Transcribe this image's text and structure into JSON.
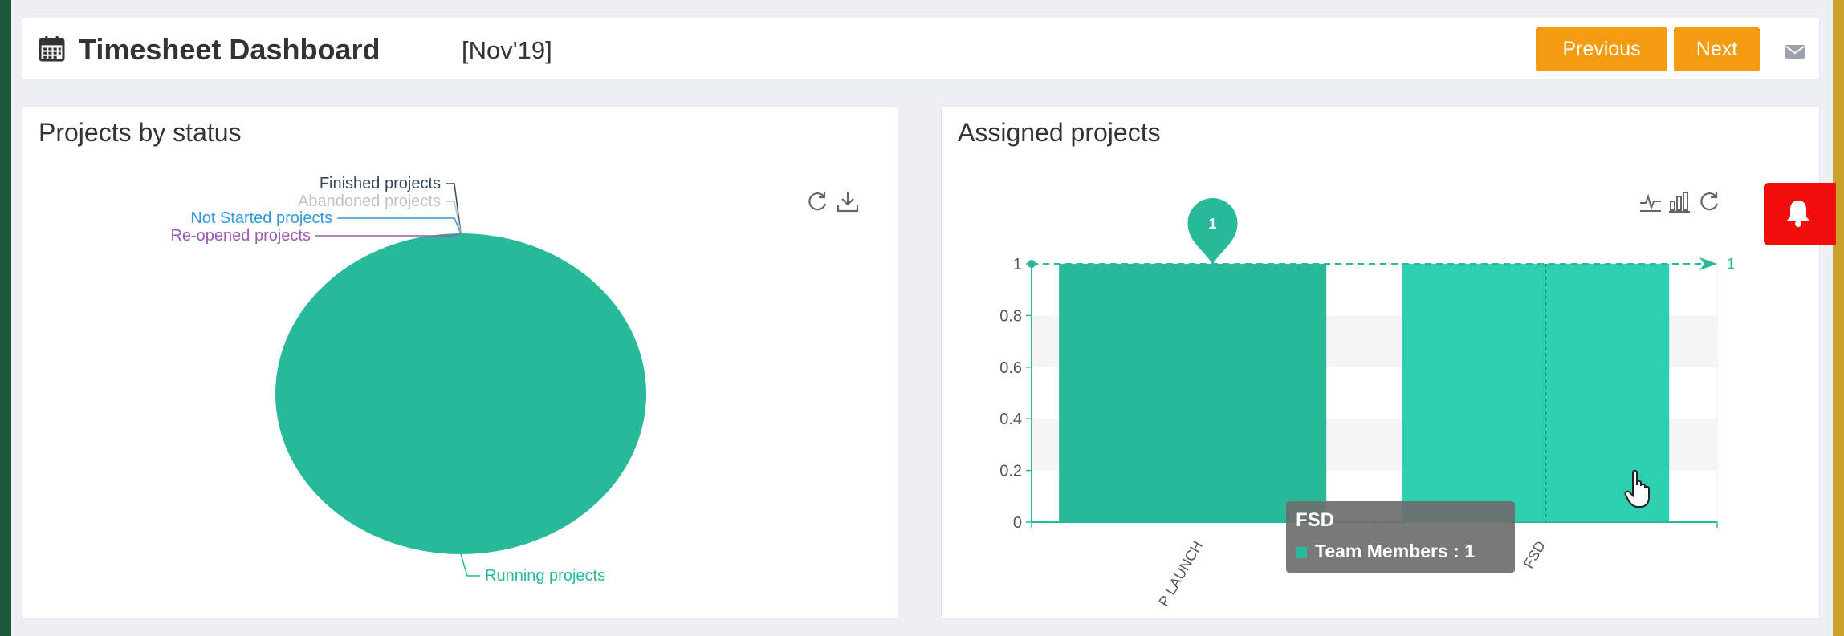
{
  "header": {
    "title": "Timesheet Dashboard",
    "period": "[Nov'19]",
    "icon": "calendar-icon",
    "previous_label": "Previous",
    "next_label": "Next",
    "mail_icon": "envelope-icon"
  },
  "projects_by_status": {
    "title": "Projects by status",
    "tools": [
      "refresh-icon",
      "download-icon"
    ],
    "chart_data": {
      "type": "pie",
      "categories": [
        "Finished projects",
        "Abandoned projects",
        "Not Started projects",
        "Re-opened projects",
        "Running projects"
      ],
      "values": [
        0,
        0,
        0,
        0,
        1
      ],
      "colors": [
        "#34495e",
        "#bdc3c7",
        "#3498db",
        "#9b59b6",
        "#26b99a"
      ]
    }
  },
  "assigned_projects": {
    "title": "Assigned projects",
    "tools": [
      "line-chart-icon",
      "bar-chart-icon",
      "refresh-icon"
    ],
    "chart_data": {
      "type": "bar",
      "categories": [
        "P LAUNCH",
        "FSD"
      ],
      "values": [
        1,
        1
      ],
      "ylim": [
        0,
        1
      ],
      "yticks": [
        "0",
        "0.2",
        "0.4",
        "0.6",
        "0.8",
        "1"
      ],
      "markline_value": "1",
      "markpoint_value": "1",
      "colors": [
        "#26b99a",
        "#2ecfae"
      ]
    },
    "tooltip": {
      "title": "FSD",
      "series": "Team Members",
      "value": "1",
      "text": "Team Members : 1"
    }
  },
  "notification_icon": "bell-icon",
  "colors": {
    "accent": "#f39c12",
    "primary": "#26b99a",
    "alert": "#f20d0d"
  }
}
